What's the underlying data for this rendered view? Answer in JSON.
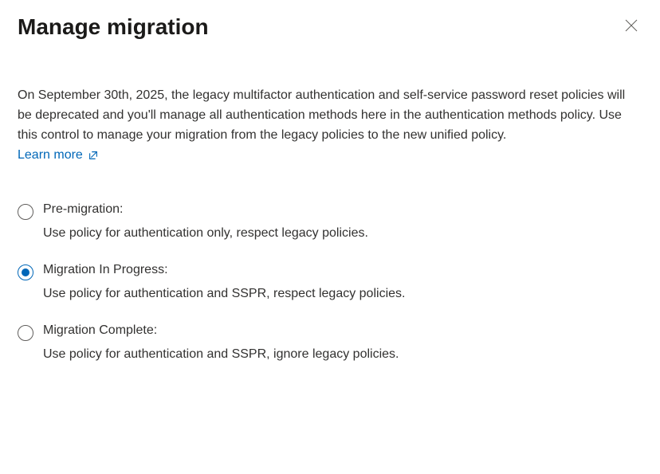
{
  "header": {
    "title": "Manage migration"
  },
  "description": "On September 30th, 2025, the legacy multifactor authentication and self-service password reset policies will be deprecated and you'll manage all authentication methods here in the authentication methods policy. Use this control to manage your migration from the legacy policies to the new unified policy.",
  "learn_more_label": "Learn more",
  "options": [
    {
      "label": "Pre-migration:",
      "description": "Use policy for authentication only, respect legacy policies.",
      "selected": false
    },
    {
      "label": "Migration In Progress:",
      "description": "Use policy for authentication and SSPR, respect legacy policies.",
      "selected": true
    },
    {
      "label": "Migration Complete:",
      "description": "Use policy for authentication and SSPR, ignore legacy policies.",
      "selected": false
    }
  ]
}
